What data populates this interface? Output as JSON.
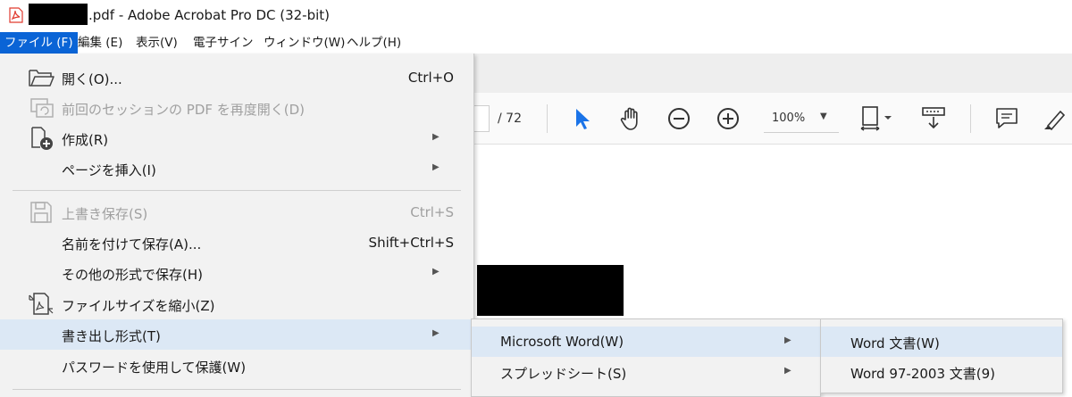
{
  "window": {
    "title": ".pdf - Adobe Acrobat Pro DC (32-bit)",
    "app_icon": "acrobat-pdf-icon"
  },
  "menubar": [
    {
      "label": "ファイル (F)",
      "active": true
    },
    {
      "label": "編集 (E)"
    },
    {
      "label": "表示(V)"
    },
    {
      "label": "電子サイン"
    },
    {
      "label": "ウィンドウ(W)"
    },
    {
      "label": "ヘルプ(H)"
    }
  ],
  "toolbar": {
    "page_total": "/  72",
    "zoom": "100%",
    "icons": [
      "select-arrow-icon",
      "hand-tool-icon",
      "zoom-out-icon",
      "zoom-in-icon",
      "page-fit-icon",
      "scroll-mode-icon",
      "comment-icon",
      "highlight-pen-icon"
    ]
  },
  "file_menu": {
    "items": [
      {
        "label": "開く(O)...",
        "shortcut": "Ctrl+O",
        "icon": "open-folder-icon"
      },
      {
        "label": "前回のセッションの PDF を再度開く(D)",
        "icon": "restore-session-icon",
        "disabled": true
      },
      {
        "label": "作成(R)",
        "icon": "create-pdf-icon",
        "submenu": true
      },
      {
        "label": "ページを挿入(I)",
        "submenu": true
      },
      {
        "label": "上書き保存(S)",
        "shortcut": "Ctrl+S",
        "icon": "save-icon",
        "disabled": true
      },
      {
        "label": "名前を付けて保存(A)...",
        "shortcut": "Shift+Ctrl+S"
      },
      {
        "label": "その他の形式で保存(H)",
        "submenu": true
      },
      {
        "label": "ファイルサイズを縮小(Z)",
        "icon": "reduce-size-icon"
      },
      {
        "label": "書き出し形式(T)",
        "submenu": true,
        "highlighted": true
      },
      {
        "label": "パスワードを使用して保護(W)"
      }
    ]
  },
  "export_submenu": {
    "items": [
      {
        "label": "Microsoft Word(W)",
        "submenu": true,
        "highlighted": true
      },
      {
        "label": "スプレッドシート(S)",
        "submenu": true
      }
    ]
  },
  "word_submenu": {
    "items": [
      {
        "label": "Word 文書(W)",
        "highlighted": true
      },
      {
        "label": "Word 97-2003 文書(9)"
      }
    ]
  },
  "colors": {
    "menu_active": "#0a64d6",
    "menu_bg": "#f2f2f2",
    "hover": "#dce8f5",
    "accent_blue": "#1a73e8",
    "acrobat_red": "#e03a2f",
    "disabled_text": "#a0a0a0"
  }
}
